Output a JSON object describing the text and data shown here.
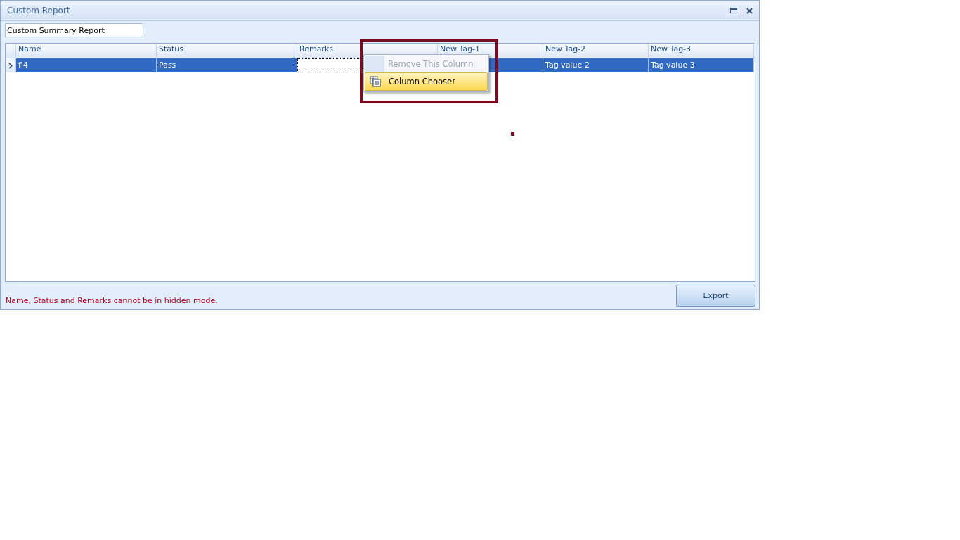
{
  "window": {
    "title": "Custom Report"
  },
  "report_name": {
    "value": "Custom Summary Report"
  },
  "table": {
    "columns": [
      "Name",
      "Status",
      "Remarks",
      "New Tag-1",
      "New Tag-2",
      "New Tag-3"
    ],
    "rows": [
      {
        "selected": true,
        "cells": [
          {
            "text": "fl4",
            "focused": false
          },
          {
            "text": "Pass",
            "focused": false
          },
          {
            "focused": true
          },
          {
            "focused": false
          },
          {
            "text": "Tag value 2",
            "focused": false
          },
          {
            "text": "Tag value 3",
            "focused": false
          }
        ]
      }
    ]
  },
  "context_menu": {
    "items": [
      {
        "label": "Remove This Column",
        "disabled": true,
        "selected": false
      },
      {
        "label": "Column Chooser",
        "disabled": false,
        "selected": true
      }
    ]
  },
  "footer": {
    "message": "Name, Status and  Remarks cannot be in hidden mode.",
    "button": "Export"
  }
}
